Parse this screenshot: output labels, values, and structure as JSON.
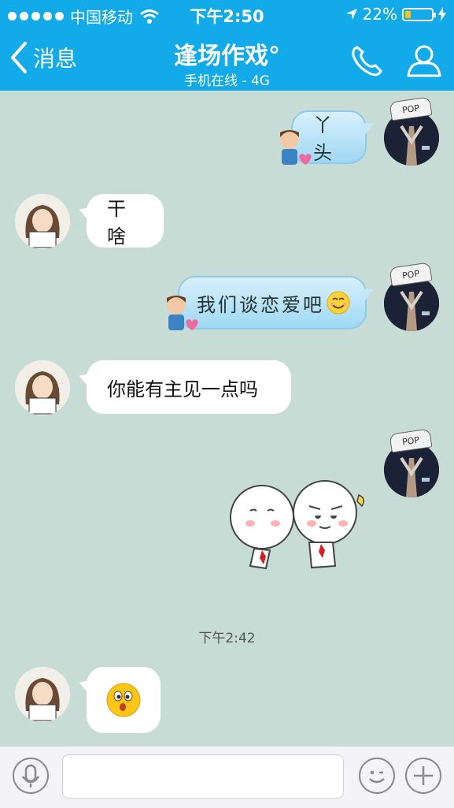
{
  "status": {
    "carrier": "中国移动",
    "time": "下午2:50",
    "battery": "22%",
    "battery_level": 0.22
  },
  "nav": {
    "back_label": "消息",
    "title": "逢场作戏°",
    "subtitle": "手机在线 - 4G"
  },
  "messages": [
    {
      "side": "right",
      "text": "丫头"
    },
    {
      "side": "left",
      "text": "干啥"
    },
    {
      "side": "right",
      "text": "我们谈恋爱吧"
    },
    {
      "side": "left",
      "text": "你能有主见一点吗"
    },
    {
      "side": "right",
      "type": "sticker"
    },
    {
      "side": "left",
      "type": "emoji"
    }
  ],
  "timestamp": "下午2:42",
  "colors": {
    "nav": "#12aae9",
    "chat_bg": "#c7dcd5"
  },
  "icons": [
    "wifi-icon",
    "location-arrow-icon",
    "charging-icon",
    "back-chevron-icon",
    "phone-icon",
    "contact-icon",
    "microphone-icon",
    "emoji-icon",
    "plus-icon"
  ],
  "avatar_text": {
    "cap": "POP"
  }
}
